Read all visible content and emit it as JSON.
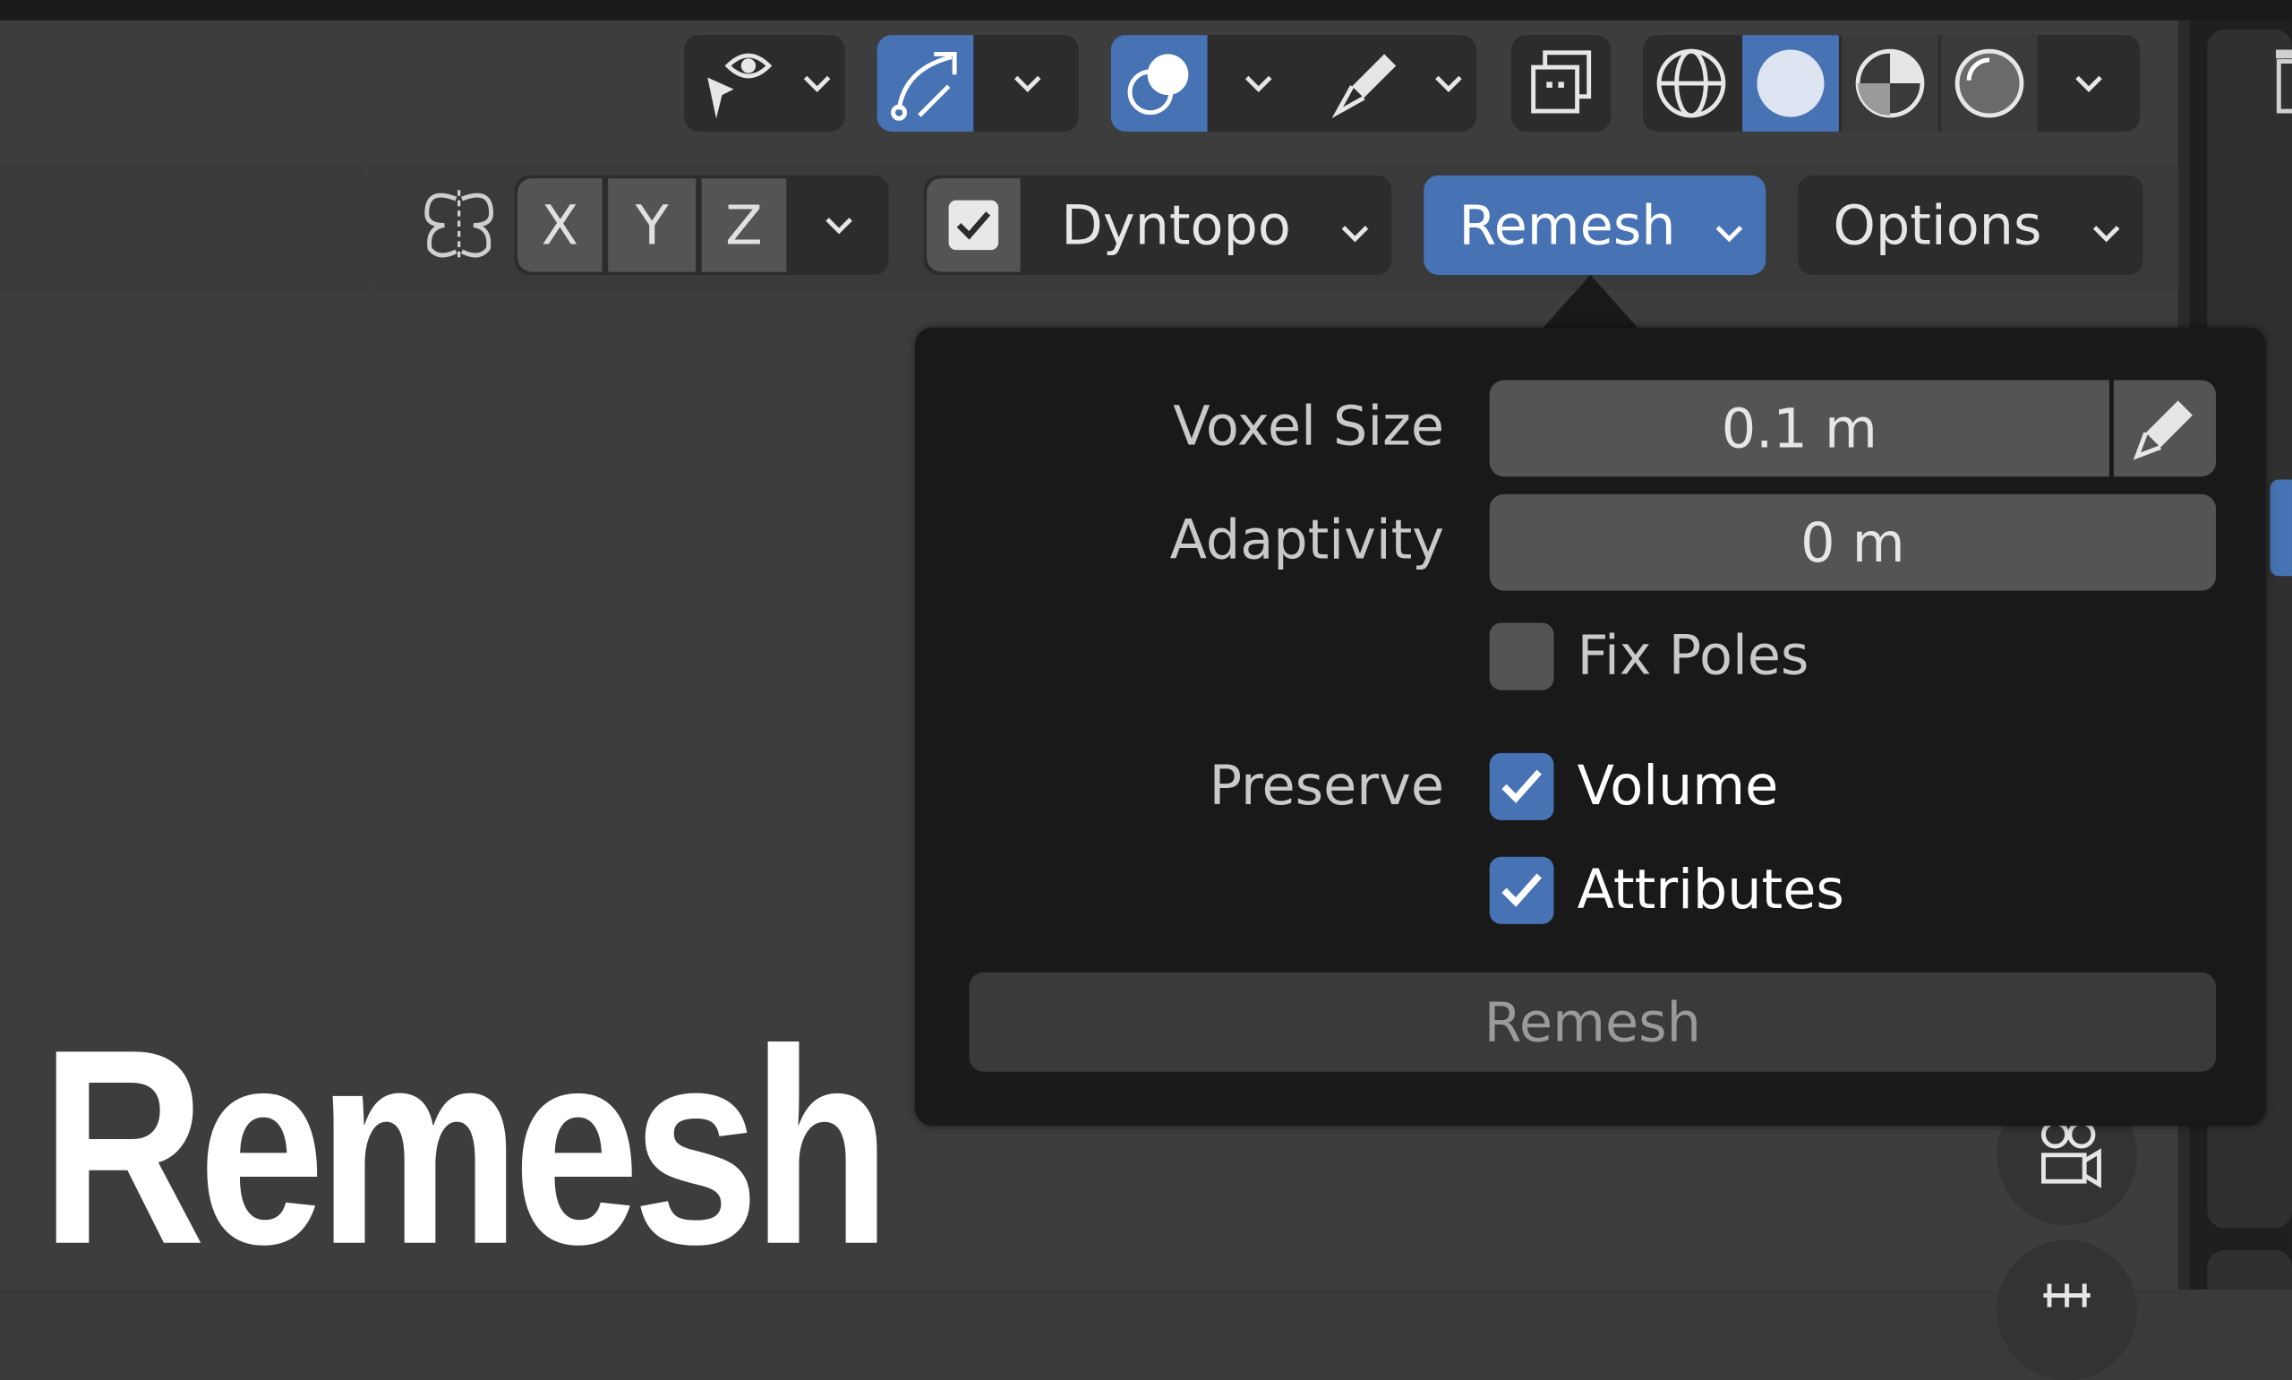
{
  "title_overlay": "Remesh",
  "header": {
    "symmetry": {
      "x": "X",
      "y": "Y",
      "z": "Z"
    },
    "dyntopo": {
      "label": "Dyntopo",
      "checked": true
    },
    "remesh_menu": {
      "label": "Remesh",
      "active": true
    },
    "options_menu": {
      "label": "Options"
    }
  },
  "viewport_shading": {
    "modes": [
      "wireframe",
      "solid",
      "material-preview",
      "rendered"
    ],
    "active": "solid"
  },
  "remesh_popup": {
    "voxel_size": {
      "label": "Voxel Size",
      "value": "0.1 m"
    },
    "adaptivity": {
      "label": "Adaptivity",
      "value": "0 m"
    },
    "fix_poles": {
      "label": "Fix Poles",
      "checked": false
    },
    "preserve": {
      "label": "Preserve",
      "volume": {
        "label": "Volume",
        "checked": true
      },
      "attributes": {
        "label": "Attributes",
        "checked": true
      }
    },
    "action_label": "Remesh"
  },
  "colors": {
    "accent": "#4772b3",
    "popup_bg": "#191919",
    "field_bg": "#545454",
    "viewport_bg": "#3d3d3d"
  }
}
